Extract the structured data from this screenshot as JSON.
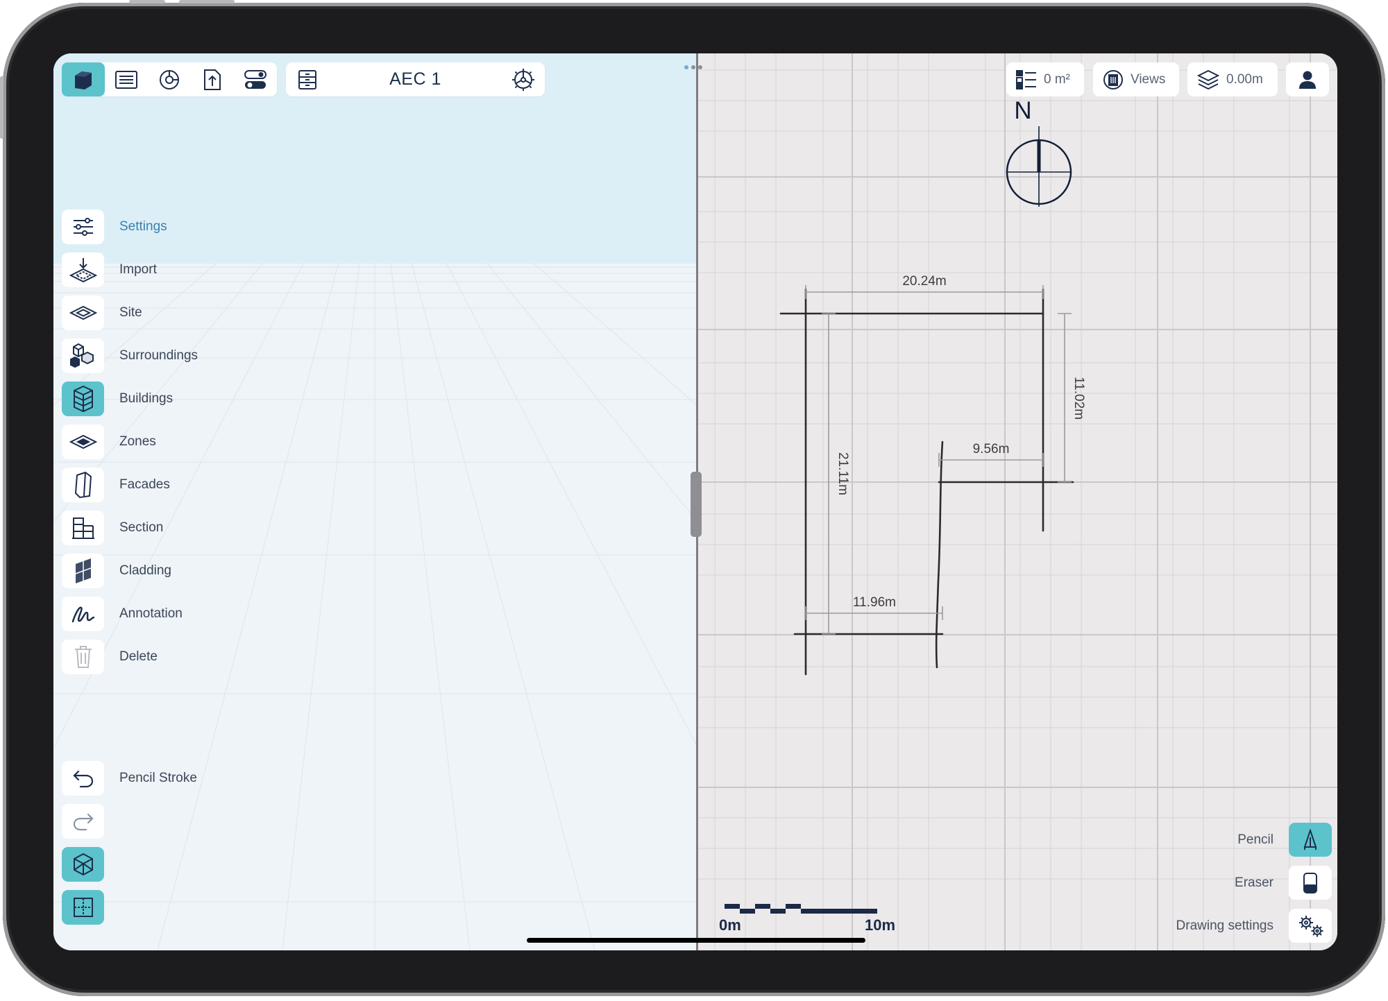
{
  "project": {
    "title": "AEC 1"
  },
  "toolbar_left": {
    "icons": [
      "3d-view-icon",
      "list-icon",
      "chart-icon",
      "export-icon",
      "toggles-icon"
    ],
    "storage_icon": "storage-icon",
    "settings_icon": "gear-icon"
  },
  "sidebar": {
    "items": [
      {
        "label": "Settings",
        "icon": "sliders-icon",
        "selected": true
      },
      {
        "label": "Import",
        "icon": "import-icon"
      },
      {
        "label": "Site",
        "icon": "site-icon"
      },
      {
        "label": "Surroundings",
        "icon": "surroundings-icon"
      },
      {
        "label": "Buildings",
        "icon": "building-icon",
        "active": true
      },
      {
        "label": "Zones",
        "icon": "zones-icon"
      },
      {
        "label": "Facades",
        "icon": "facade-icon"
      },
      {
        "label": "Section",
        "icon": "section-icon"
      },
      {
        "label": "Cladding",
        "icon": "cladding-icon"
      },
      {
        "label": "Annotation",
        "icon": "annotation-icon"
      },
      {
        "label": "Delete",
        "icon": "trash-icon"
      }
    ],
    "history": {
      "undo_label": "Pencil Stroke",
      "undo_icon": "undo-icon",
      "redo_icon": "redo-icon"
    },
    "view_buttons": [
      "cube-icon",
      "floorplan-icon"
    ]
  },
  "top_right": {
    "area": "0 m²",
    "views_label": "Views",
    "elevation": "0.00m",
    "profile_icon": "user-icon"
  },
  "compass": {
    "label": "N"
  },
  "drawing": {
    "dimensions": [
      "20.24m",
      "11.02m",
      "9.56m",
      "21.11m",
      "11.96m"
    ]
  },
  "scale_bar": {
    "start": "0m",
    "end": "10m"
  },
  "tools": {
    "pencil_label": "Pencil",
    "eraser_label": "Eraser",
    "settings_label": "Drawing settings"
  },
  "colors": {
    "accent": "#5cc3cc",
    "navy": "#1d2e4c",
    "highlight": "#dceff6"
  }
}
